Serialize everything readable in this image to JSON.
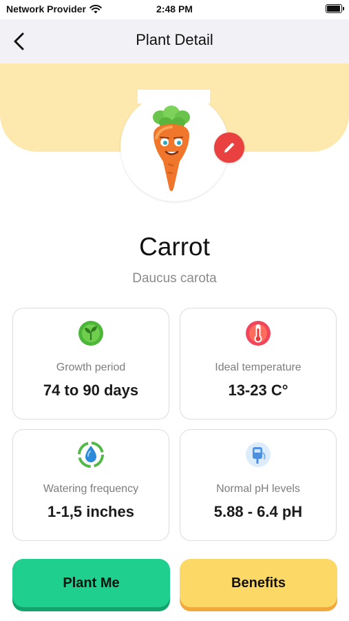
{
  "status_bar": {
    "carrier": "Network Provider",
    "time": "2:48 PM"
  },
  "nav": {
    "title": "Plant Detail"
  },
  "plant": {
    "name": "Carrot",
    "scientific_name": "Daucus carota"
  },
  "stats": [
    {
      "icon": "sprout-icon",
      "label": "Growth period",
      "value": "74 to 90 days"
    },
    {
      "icon": "thermometer-icon",
      "label": "Ideal temperature",
      "value": "13-23 C°"
    },
    {
      "icon": "water-drop-icon",
      "label": "Watering frequency",
      "value": "1-1,5 inches"
    },
    {
      "icon": "ph-meter-icon",
      "label": "Normal pH levels",
      "value": "5.88 - 6.4 pH"
    }
  ],
  "buttons": {
    "plant_me": "Plant Me",
    "benefits": "Benefits"
  },
  "colors": {
    "hero_band": "#fde8ad",
    "edit_button": "#e94040",
    "plant_me": "#1fcf8e",
    "benefits": "#fcd867"
  }
}
